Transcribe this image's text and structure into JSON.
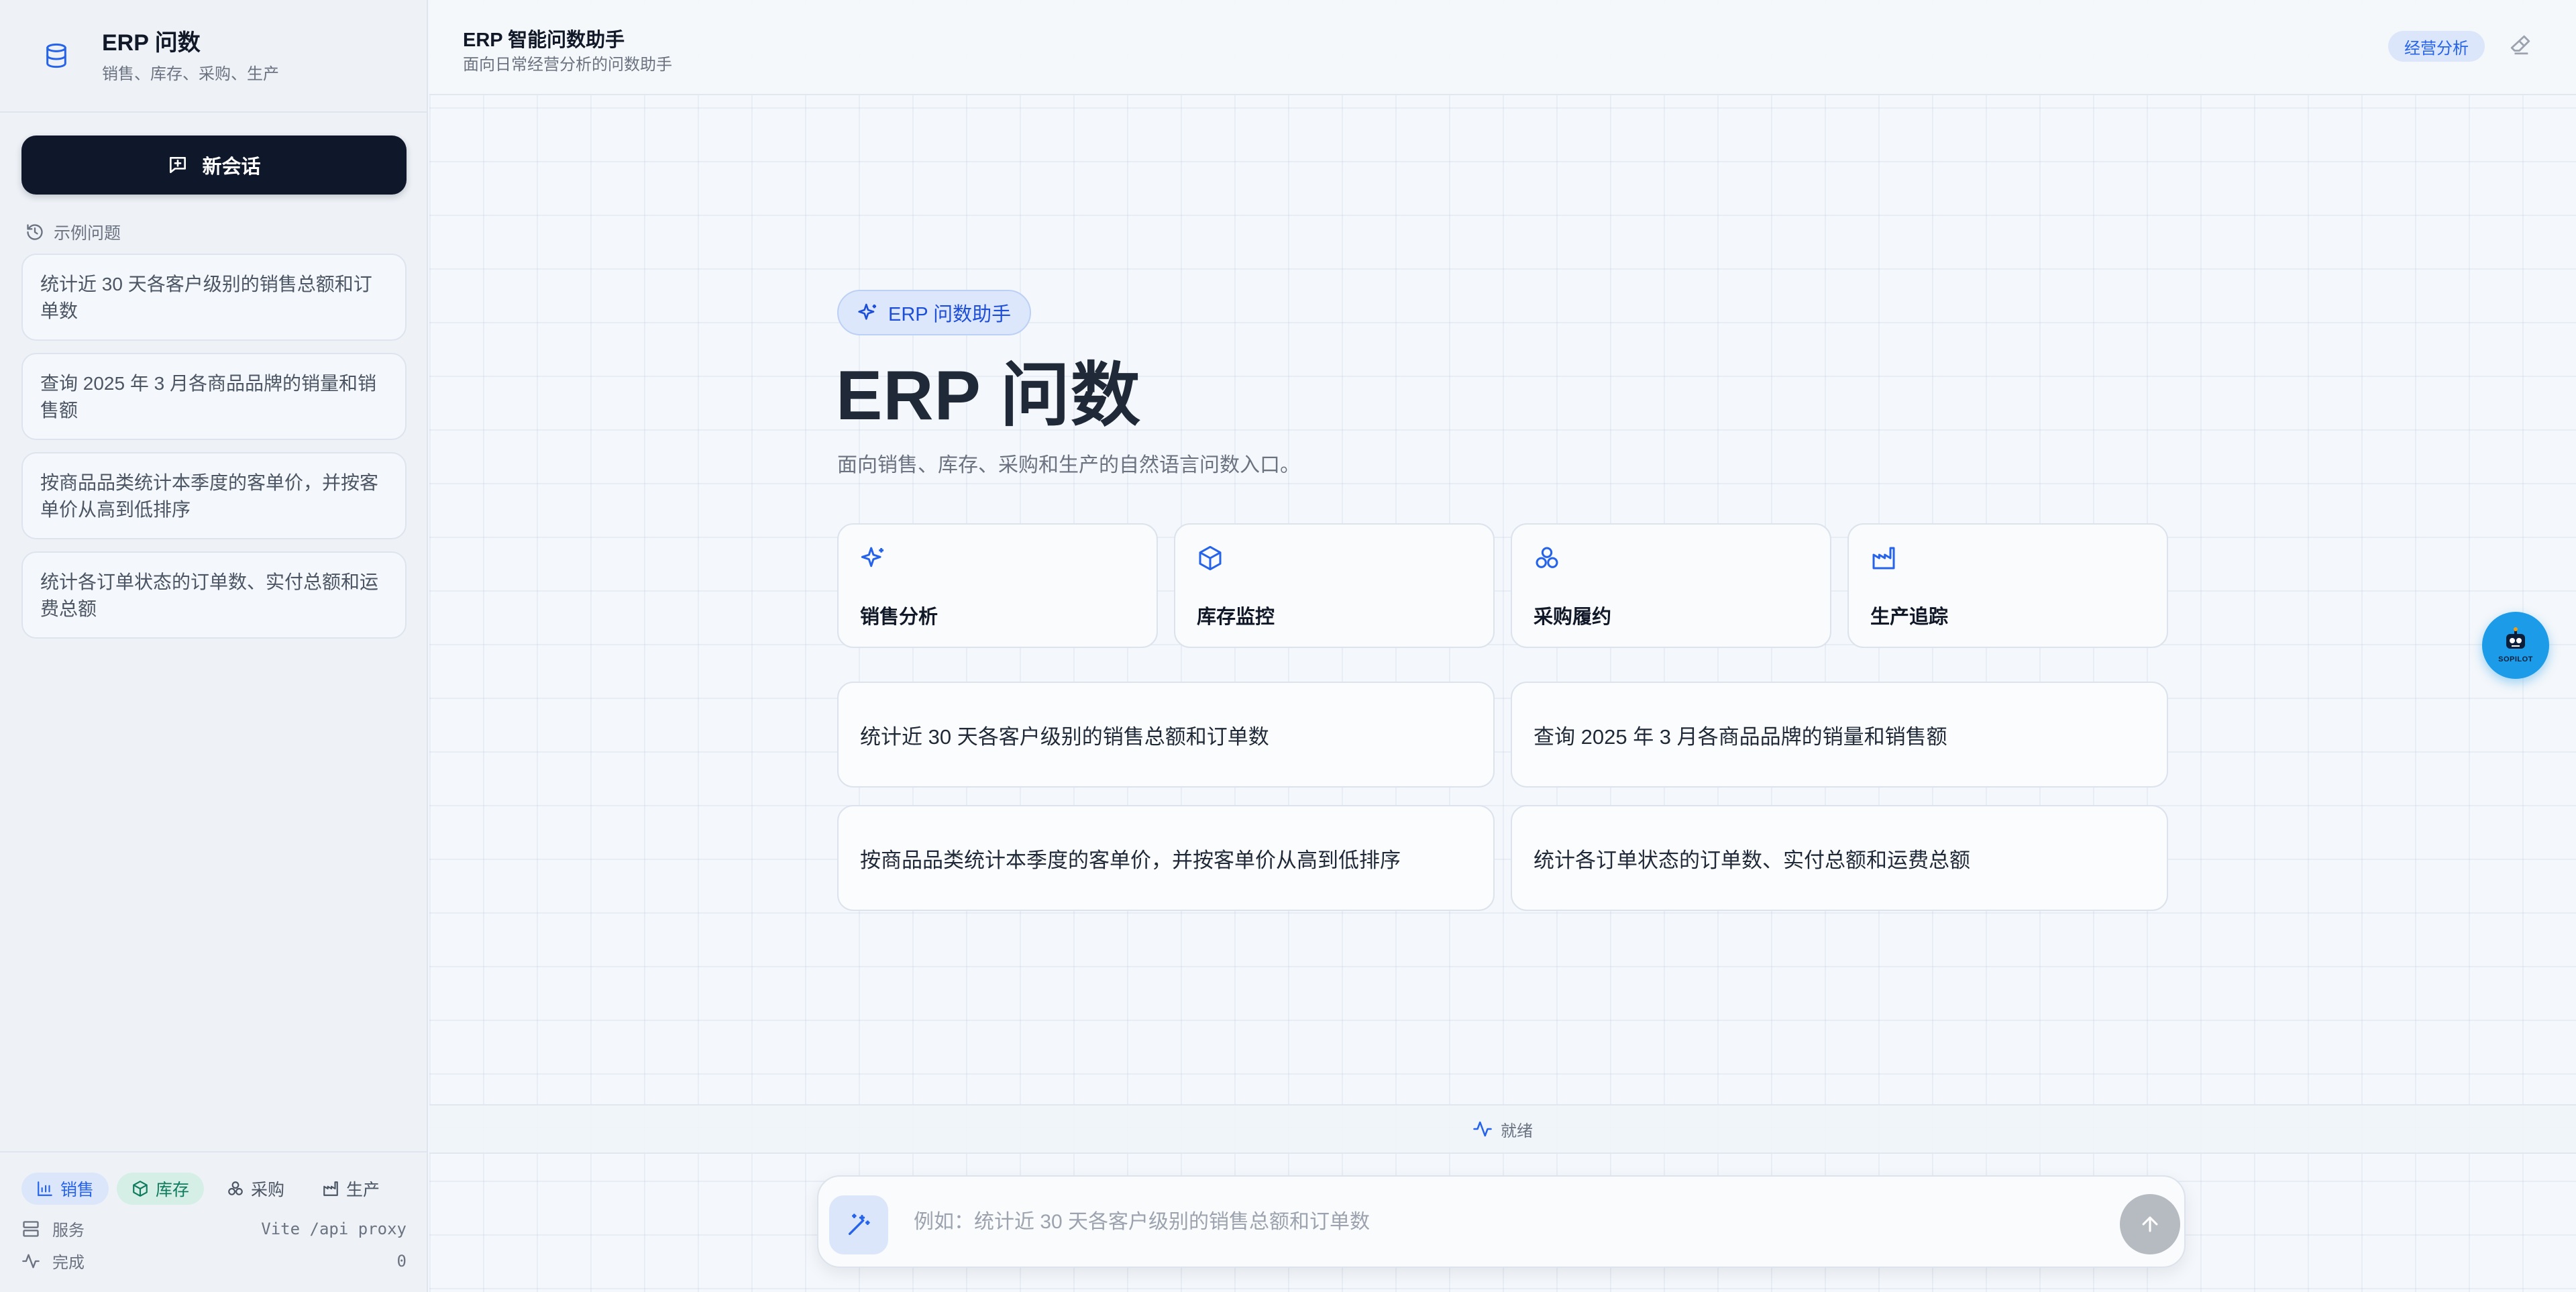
{
  "sidebar": {
    "title": "ERP 问数",
    "subtitle": "销售、库存、采购、生产",
    "new_chat_label": "新会话",
    "examples_label": "示例问题",
    "examples": [
      "统计近 30 天各客户级别的销售总额和订单数",
      "查询 2025 年 3 月各商品品牌的销量和销售额",
      "按商品品类统计本季度的客单价，并按客单价从高到低排序",
      "统计各订单状态的订单数、实付总额和运费总额"
    ],
    "chips": [
      "销售",
      "库存",
      "采购",
      "生产"
    ],
    "service_label": "服务",
    "service_value": "Vite /api proxy",
    "done_label": "完成",
    "done_value": "0"
  },
  "topbar": {
    "title": "ERP 智能问数助手",
    "subtitle": "面向日常经营分析的问数助手",
    "badge": "经营分析"
  },
  "hero": {
    "badge": "ERP 问数助手",
    "title": "ERP 问数",
    "subtitle": "面向销售、库存、采购和生产的自然语言问数入口。"
  },
  "categories": [
    {
      "label": "销售分析",
      "icon": "sparkles-icon"
    },
    {
      "label": "库存监控",
      "icon": "package-icon"
    },
    {
      "label": "采购履约",
      "icon": "boxes-icon"
    },
    {
      "label": "生产追踪",
      "icon": "factory-icon"
    }
  ],
  "questions": [
    "统计近 30 天各客户级别的销售总额和订单数",
    "查询 2025 年 3 月各商品品牌的销量和销售额",
    "按商品品类统计本季度的客单价，并按客单价从高到低排序",
    "统计各订单状态的订单数、实付总额和运费总额"
  ],
  "status": {
    "text": "就绪"
  },
  "composer": {
    "placeholder": "例如：统计近 30 天各客户级别的销售总额和订单数"
  },
  "copilot": {
    "label": "SOPILOT"
  },
  "colors": {
    "accent": "#2563eb",
    "dark_button": "#0f172a",
    "green_chip": "#0f7a5c",
    "copilot": "#1c9be8"
  }
}
